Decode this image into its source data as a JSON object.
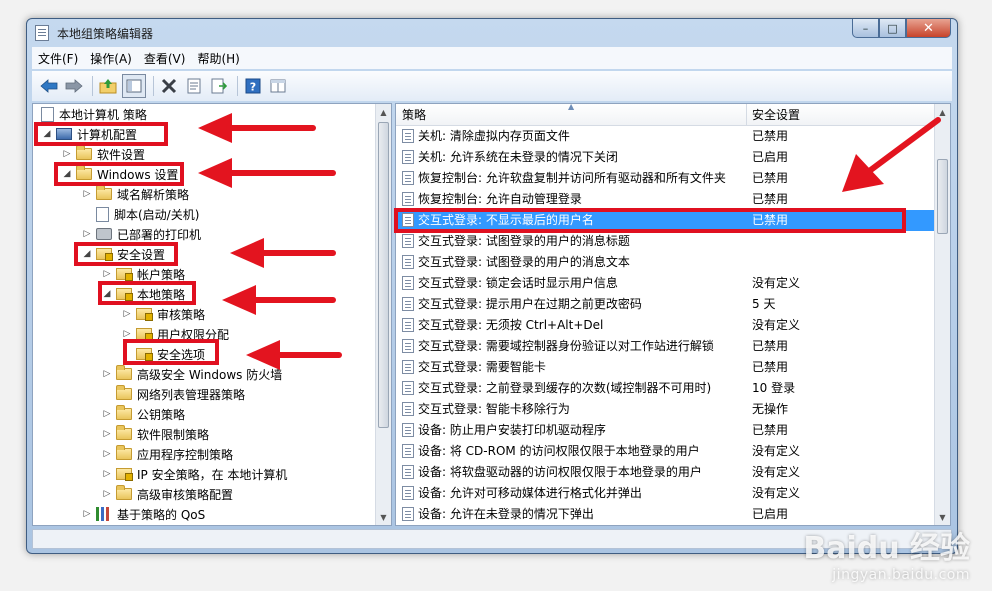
{
  "window": {
    "title": "本地组策略编辑器",
    "minimize": "–",
    "maximize": "□",
    "close": "✕"
  },
  "menu": [
    "文件(F)",
    "操作(A)",
    "查看(V)",
    "帮助(H)"
  ],
  "toolbar_icons": [
    "back-arrow-icon",
    "forward-arrow-icon",
    "up-folder-icon",
    "show-hide-tree-icon",
    "delete-icon",
    "properties-icon",
    "export-list-icon",
    "help-icon",
    "view-icon"
  ],
  "tree": {
    "root": "本地计算机 策略",
    "computer_config": "计算机配置",
    "software_settings": "软件设置",
    "windows_settings": "Windows 设置",
    "dns_policy": "域名解析策略",
    "scripts": "脚本(启动/关机)",
    "deployed_printers": "已部署的打印机",
    "security_settings": "安全设置",
    "account_policies": "帐户策略",
    "local_policies": "本地策略",
    "audit_policy": "审核策略",
    "user_rights": "用户权限分配",
    "security_options": "安全选项",
    "advanced_firewall": "高级安全 Windows 防火墙",
    "network_list": "网络列表管理器策略",
    "public_key": "公钥策略",
    "software_restriction": "软件限制策略",
    "app_control": "应用程序控制策略",
    "ip_security": "IP 安全策略，在 本地计算机",
    "advanced_audit": "高级审核策略配置",
    "qos": "基于策略的 QoS"
  },
  "list": {
    "col_policy": "策略",
    "col_setting": "安全设置",
    "rows": [
      {
        "policy": "关机: 清除虚拟内存页面文件",
        "setting": "已禁用"
      },
      {
        "policy": "关机: 允许系统在未登录的情况下关闭",
        "setting": "已启用"
      },
      {
        "policy": "恢复控制台: 允许软盘复制并访问所有驱动器和所有文件夹",
        "setting": "已禁用"
      },
      {
        "policy": "恢复控制台: 允许自动管理登录",
        "setting": "已禁用"
      },
      {
        "policy": "交互式登录: 不显示最后的用户名",
        "setting": "已禁用"
      },
      {
        "policy": "交互式登录: 试图登录的用户的消息标题",
        "setting": ""
      },
      {
        "policy": "交互式登录: 试图登录的用户的消息文本",
        "setting": ""
      },
      {
        "policy": "交互式登录: 锁定会话时显示用户信息",
        "setting": "没有定义"
      },
      {
        "policy": "交互式登录: 提示用户在过期之前更改密码",
        "setting": "5 天"
      },
      {
        "policy": "交互式登录: 无须按 Ctrl+Alt+Del",
        "setting": "没有定义"
      },
      {
        "policy": "交互式登录: 需要域控制器身份验证以对工作站进行解锁",
        "setting": "已禁用"
      },
      {
        "policy": "交互式登录: 需要智能卡",
        "setting": "已禁用"
      },
      {
        "policy": "交互式登录: 之前登录到缓存的次数(域控制器不可用时)",
        "setting": "10 登录"
      },
      {
        "policy": "交互式登录: 智能卡移除行为",
        "setting": "无操作"
      },
      {
        "policy": "设备: 防止用户安装打印机驱动程序",
        "setting": "已禁用"
      },
      {
        "policy": "设备: 将 CD-ROM 的访问权限仅限于本地登录的用户",
        "setting": "没有定义"
      },
      {
        "policy": "设备: 将软盘驱动器的访问权限仅限于本地登录的用户",
        "setting": "没有定义"
      },
      {
        "policy": "设备: 允许对可移动媒体进行格式化并弹出",
        "setting": "没有定义"
      },
      {
        "policy": "设备: 允许在未登录的情况下弹出",
        "setting": "已启用"
      }
    ]
  },
  "watermark": {
    "logo": "Baidu 经验",
    "url": "jingyan.baidu.com"
  },
  "colors": {
    "highlight": "#e01020",
    "selection": "#3399ff"
  }
}
